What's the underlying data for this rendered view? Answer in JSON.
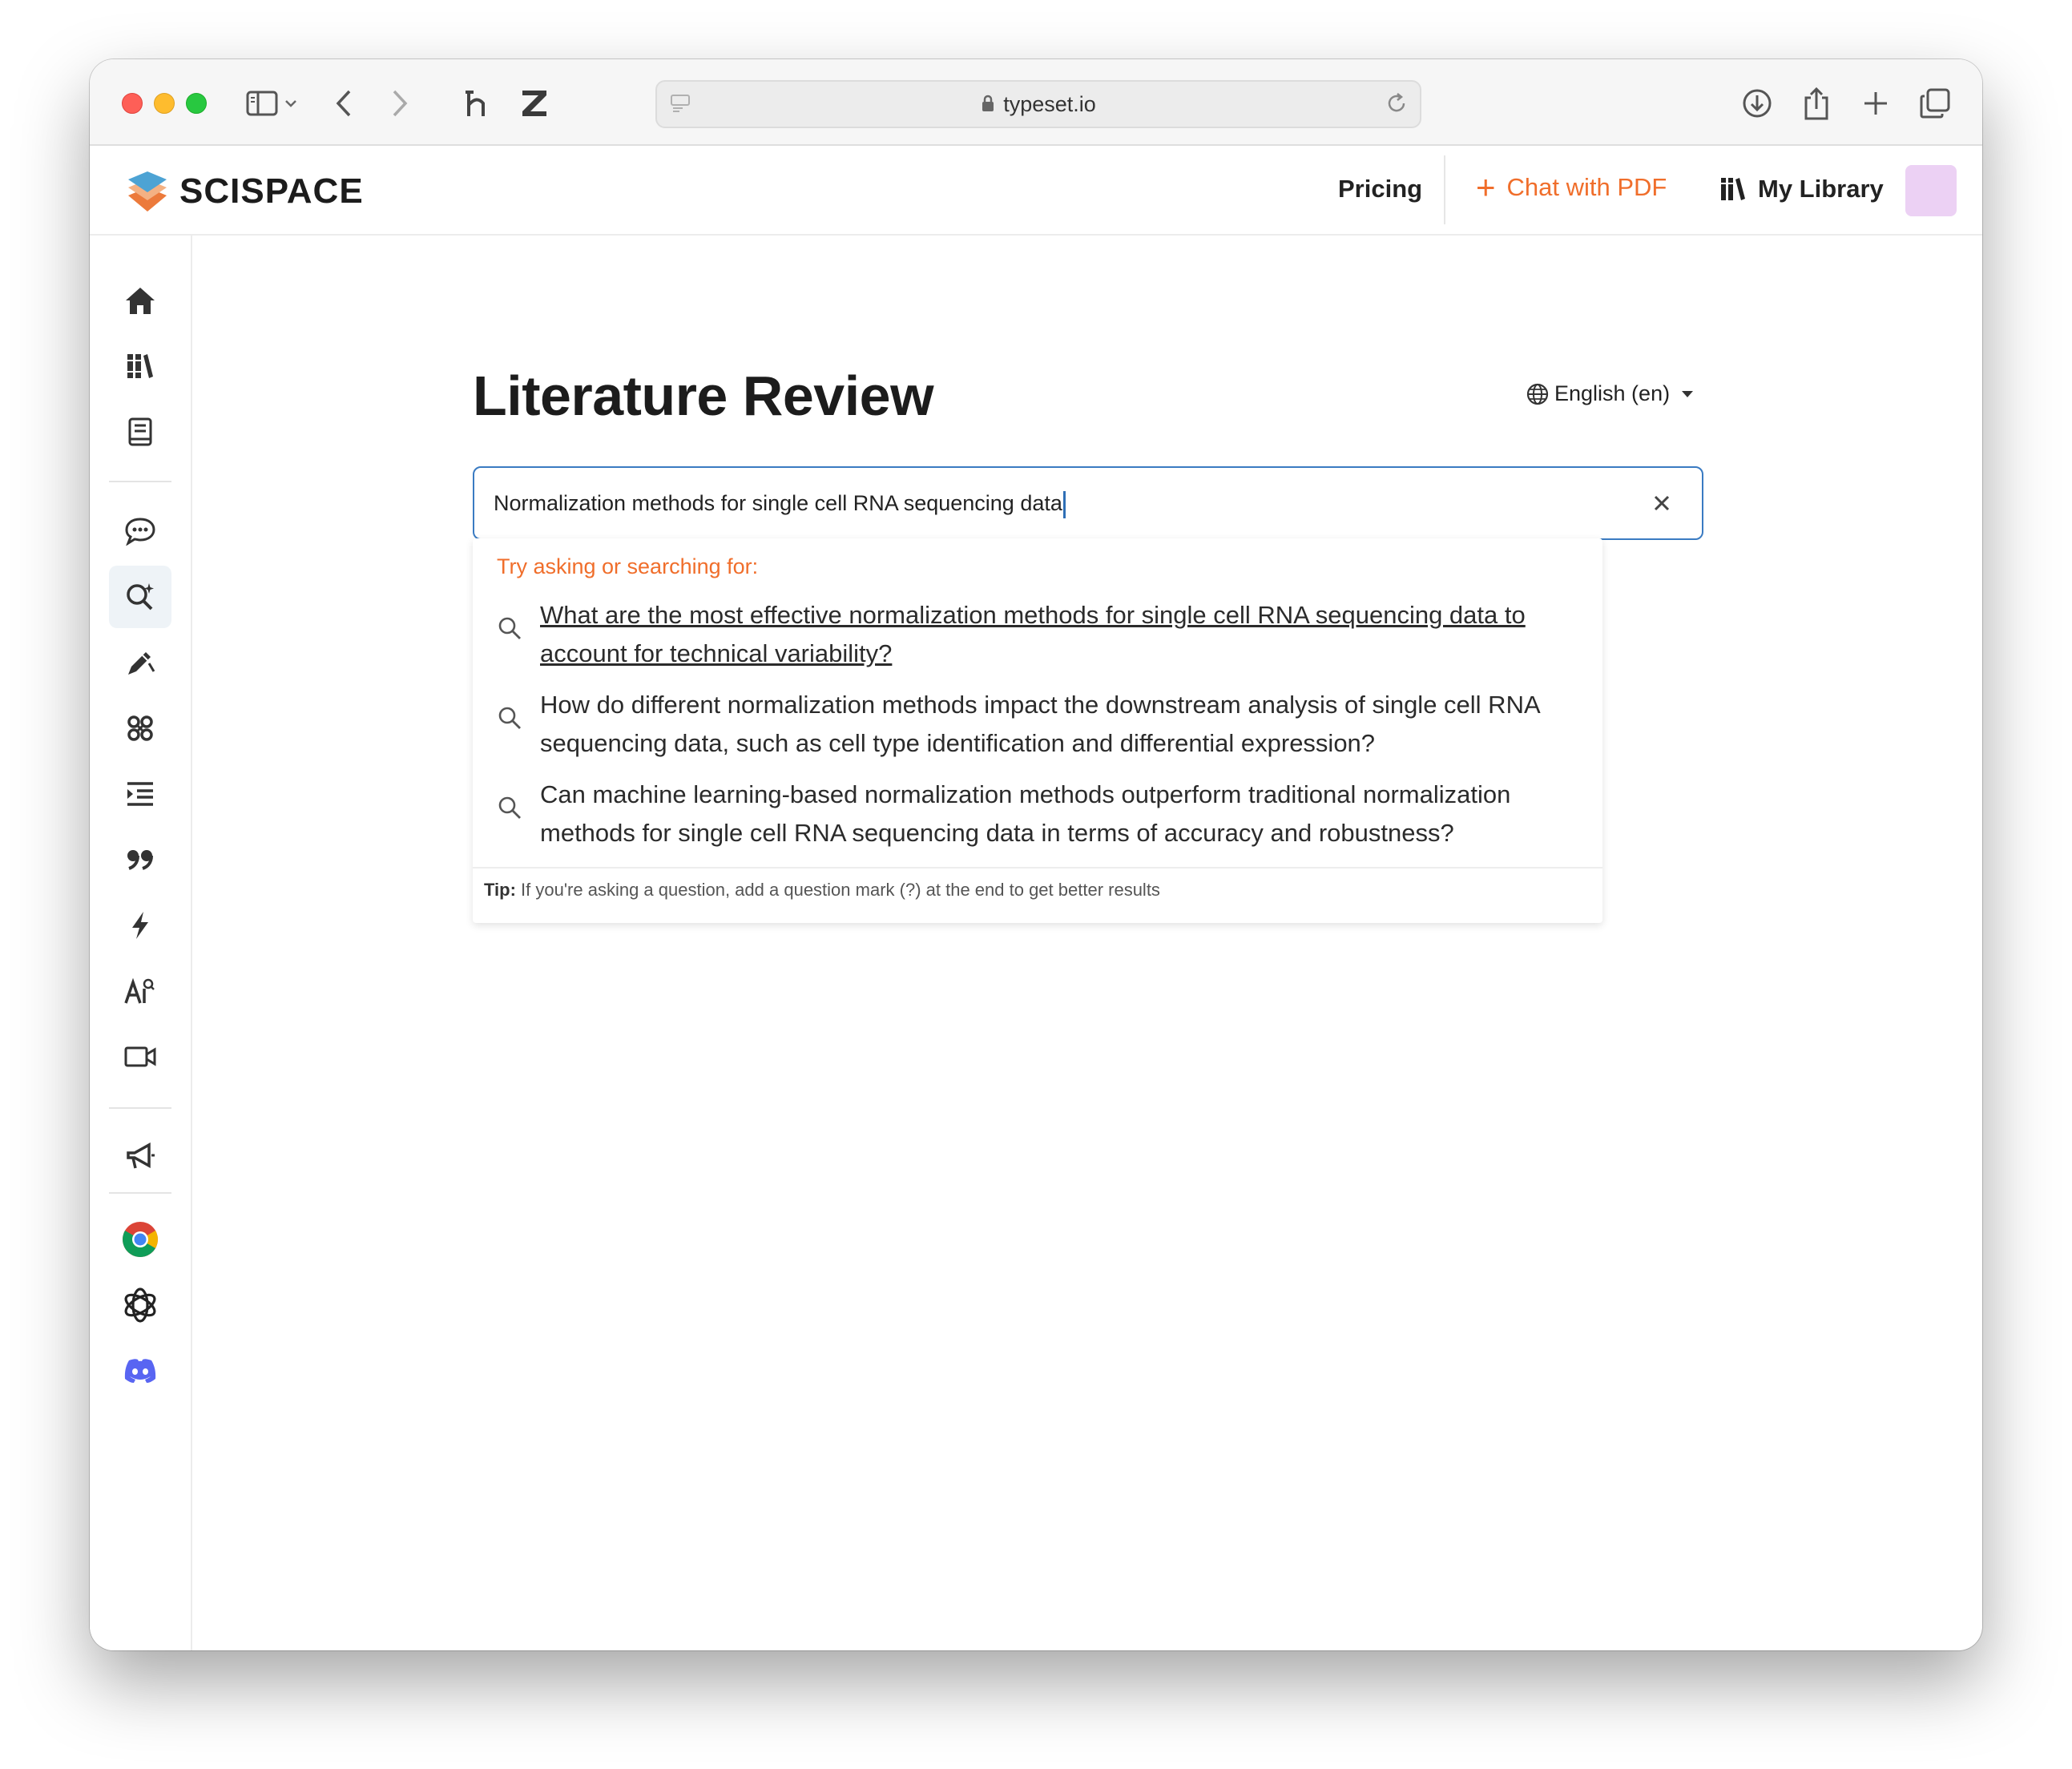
{
  "browser": {
    "url": "typeset.io"
  },
  "header": {
    "logo_text": "SCISPACE",
    "pricing": "Pricing",
    "chat_pdf": "Chat with PDF",
    "my_library": "My Library"
  },
  "sidebar": {
    "items": [
      {
        "icon": "home-icon"
      },
      {
        "icon": "library-icon"
      },
      {
        "icon": "notebook-icon"
      },
      {
        "icon": "chat-icon"
      },
      {
        "icon": "literature-review-search-icon",
        "active": true
      },
      {
        "icon": "pen-icon"
      },
      {
        "icon": "topics-icon"
      },
      {
        "icon": "paraphrase-icon"
      },
      {
        "icon": "citation-quote-icon"
      },
      {
        "icon": "lightning-icon"
      },
      {
        "icon": "ai-detector-icon"
      },
      {
        "icon": "video-icon"
      },
      {
        "icon": "megaphone-icon"
      },
      {
        "icon": "chrome-icon"
      },
      {
        "icon": "openai-icon"
      },
      {
        "icon": "discord-icon"
      }
    ]
  },
  "main": {
    "title": "Literature Review",
    "language": "English (en)",
    "search": {
      "value": "Normalization methods for single cell RNA sequencing data"
    },
    "dropdown": {
      "heading": "Try asking or searching for:",
      "suggestions": [
        "What are the most effective normalization methods for single cell RNA sequencing data to account for technical variability?",
        "How do different normalization methods impact the downstream analysis of single cell RNA sequencing data, such as cell type identification and differential expression?",
        "Can machine learning-based normalization methods outperform traditional normalization methods for single cell RNA sequencing data in terms of accuracy and robustness?"
      ],
      "tip_label": "Tip:",
      "tip_text": "If you're asking a question, add a question mark (?) at the end to get better results"
    }
  },
  "colors": {
    "accent": "#f06e2b",
    "focus_border": "#3a7bc2",
    "help_button": "#2f6fb6",
    "avatar": "#ecd1f4"
  }
}
